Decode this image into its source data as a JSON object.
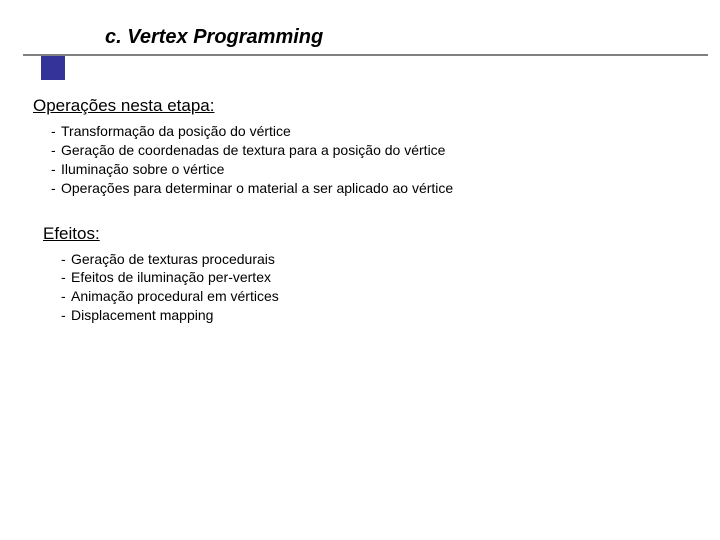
{
  "slide": {
    "title": "c. Vertex Programming",
    "section1": {
      "heading": "Operações nesta etapa:",
      "items": [
        "Transformação da posição do vértice",
        "Geração de coordenadas de textura para a posição do vértice",
        "Iluminação sobre o vértice",
        "Operações para determinar o material a ser aplicado ao vértice"
      ]
    },
    "section2": {
      "heading": "Efeitos:",
      "items": [
        "Geração de texturas procedurais",
        "Efeitos de iluminação per-vertex",
        "Animação procedural em vértices",
        "Displacement mapping"
      ]
    }
  }
}
